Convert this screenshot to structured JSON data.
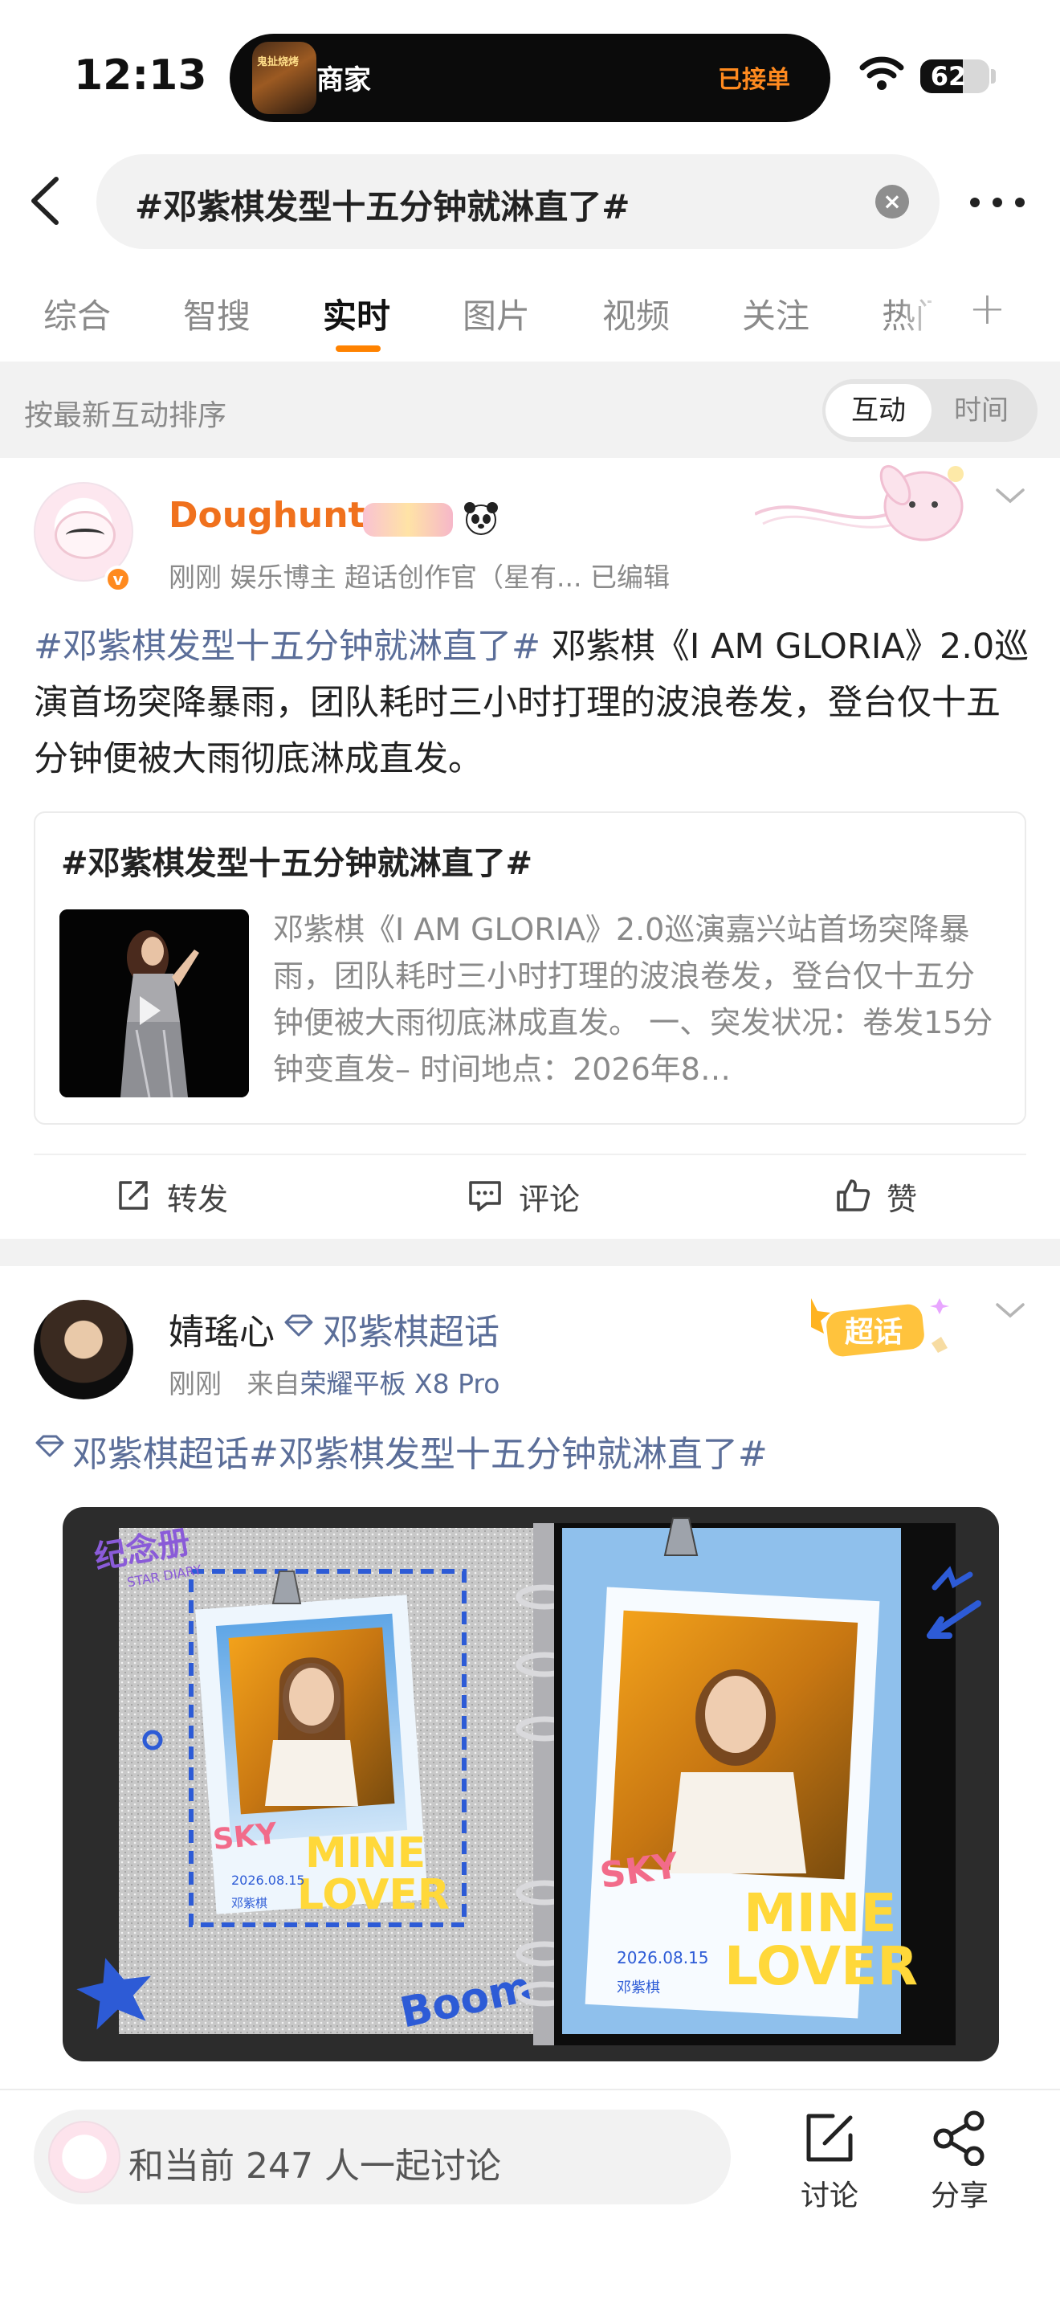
{
  "status_bar": {
    "time": "12:13",
    "island_thumb_text": "鬼扯烧烤",
    "island_app": "商家",
    "island_status": "已接单",
    "battery": "62",
    "battery_level": 0.62
  },
  "search": {
    "query": "#邓紫棋发型十五分钟就淋直了#"
  },
  "tabs": [
    "综合",
    "智搜",
    "实时",
    "图片",
    "视频",
    "关注",
    "热门"
  ],
  "active_tab": "实时",
  "sort": {
    "label": "按最新互动排序",
    "options": [
      "互动",
      "时间"
    ],
    "active": "互动"
  },
  "post1": {
    "author": "Doughunt-",
    "meta": "刚刚  娱乐博主 超话创作官（星有...  已编辑",
    "hashtag": "#邓紫棋发型十五分钟就淋直了#",
    "text": " 邓紫棋《I AM GLORIA》2.0巡演首场突降暴雨，团队耗时三小时打理的波浪卷发，登台仅十五分钟便被大雨彻底淋成直发。",
    "card": {
      "title": "#邓紫棋发型十五分钟就淋直了#",
      "text": "邓紫棋《I AM GLORIA》2.0巡演嘉兴站首场突降暴雨，团队耗时三小时打理的波浪卷发，登台仅十五分钟便被大雨彻底淋成直发。 一、突发状况：卷发15分钟变直发– 时间地点：2026年8…"
    },
    "actions": {
      "repost": "转发",
      "comment": "评论",
      "like": "赞"
    }
  },
  "post2": {
    "author": "婧瑤心",
    "topic": "邓紫棋超话",
    "time": "刚刚",
    "source_prefix": "来自",
    "device": "荣耀平板 X8 Pro",
    "badge": "超话",
    "line": "邓紫棋超话#邓紫棋发型十五分钟就淋直了#",
    "album": {
      "title_sticker": "纪念册",
      "subtitle_sticker": "STAR DIARY",
      "left_date": "2026.08.15",
      "right_date": "2026.08.15",
      "left_caption": "邓紫棋",
      "right_caption": "邓紫棋",
      "sky": "SKY",
      "mine": "MINE",
      "lover": "LOVER",
      "boom": "Boom!"
    }
  },
  "bottom": {
    "discuss": "和当前 247 人一起讨论",
    "discuss_btn": "讨论",
    "share_btn": "分享"
  },
  "colors": {
    "accent": "#ff8200",
    "link": "#5b6e99",
    "name_orange": "#f0711d"
  }
}
